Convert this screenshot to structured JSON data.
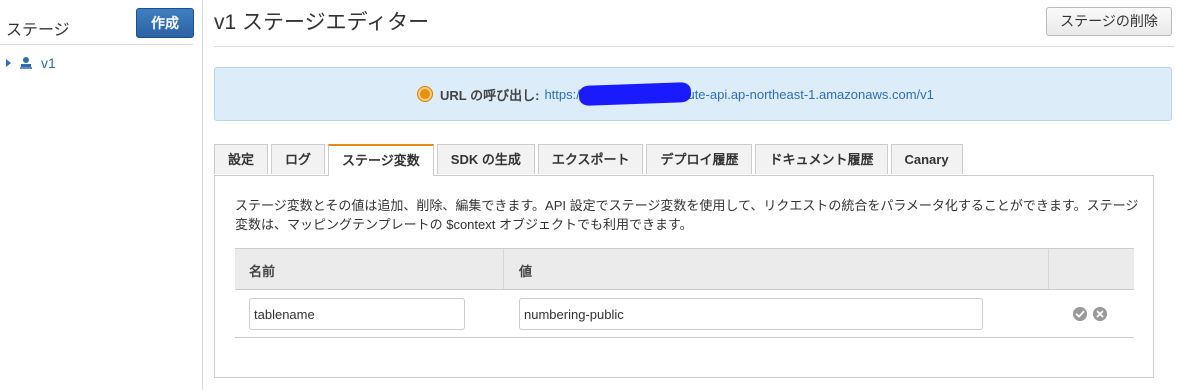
{
  "sidebar": {
    "title": "ステージ",
    "create_button": "作成",
    "items": [
      {
        "label": "v1"
      }
    ]
  },
  "header": {
    "title": "v1 ステージエディター",
    "delete_button": "ステージの削除"
  },
  "info": {
    "label": "URL の呼び出し:",
    "url_prefix": "https://",
    "url_suffix": "ute-api.ap-northeast-1.amazonaws.com/v1"
  },
  "tabs": [
    {
      "label": "設定"
    },
    {
      "label": "ログ"
    },
    {
      "label": "ステージ変数"
    },
    {
      "label": "SDK の生成"
    },
    {
      "label": "エクスポート"
    },
    {
      "label": "デプロイ履歴"
    },
    {
      "label": "ドキュメント履歴"
    },
    {
      "label": "Canary"
    }
  ],
  "active_tab": "ステージ変数",
  "panel": {
    "description": "ステージ変数とその値は追加、削除、編集できます。API 設定でステージ変数を使用して、リクエストの統合をパラメータ化することができます。ステージ変数は、マッピングテンプレートの $context オブジェクトでも利用できます。",
    "table": {
      "columns": [
        "名前",
        "値"
      ],
      "rows": [
        {
          "name": "tablename",
          "value": "numbering-public"
        }
      ]
    }
  },
  "icons": {
    "stage": "stage-icon",
    "invoke_url": "radio-icon",
    "confirm": "check-circle-icon",
    "remove": "x-circle-icon"
  },
  "colors": {
    "primary_button": "#2a63a6",
    "link": "#2f6eb5",
    "active_tab_accent": "#e8891a",
    "info_background": "#dcecf8"
  }
}
